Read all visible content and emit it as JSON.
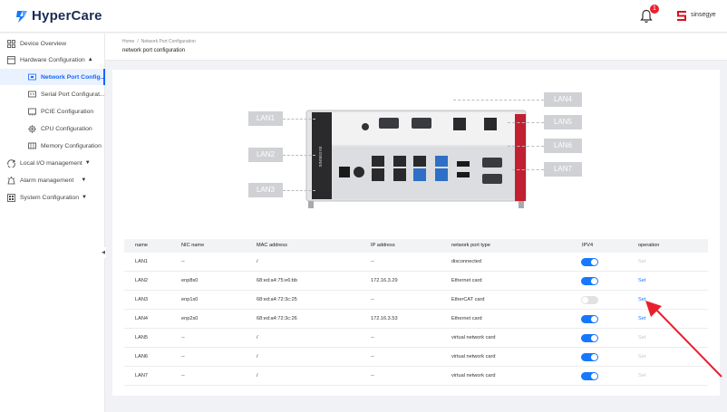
{
  "app": {
    "name": "HyperCare",
    "user": "sinsegye",
    "notification_count": "1",
    "accent_color": "#1677ff",
    "alert_color": "#e8202e"
  },
  "sidebar": {
    "items": [
      {
        "label": "Device Overview",
        "icon": "dashboard-icon"
      },
      {
        "label": "Hardware Configuration",
        "icon": "hardware-icon",
        "expanded": true
      },
      {
        "label": "Network Port Config...",
        "icon": "network-port-icon",
        "active": true
      },
      {
        "label": "Serial Port Configurat...",
        "icon": "serial-port-icon"
      },
      {
        "label": "PCIE Configuration",
        "icon": "pcie-icon"
      },
      {
        "label": "CPU Configuration",
        "icon": "cpu-icon"
      },
      {
        "label": "Memory Configuration",
        "icon": "memory-icon"
      },
      {
        "label": "Local I/O management",
        "icon": "io-icon"
      },
      {
        "label": "Alarm management",
        "icon": "alarm-icon"
      },
      {
        "label": "System Configuration",
        "icon": "system-icon"
      }
    ]
  },
  "breadcrumb": {
    "home": "Home",
    "separator": "/",
    "current": "Network Port Configuration",
    "page_title": "network port configuration"
  },
  "device_labels": [
    "LAN1",
    "LAN2",
    "LAN3",
    "LAN4",
    "LAN5",
    "LAN6",
    "LAN7"
  ],
  "device_text": {
    "brand_vertical": "SINSEGYE"
  },
  "table": {
    "columns": [
      "name",
      "NIC name",
      "MAC address",
      "IP address",
      "network port type",
      "IPV4",
      "operation"
    ],
    "rows": [
      {
        "name": "LAN1",
        "nic": "--",
        "mac": "/",
        "ip": "--",
        "type": "disconnected",
        "ipv4": true,
        "op": "Set",
        "op_enabled": false
      },
      {
        "name": "LAN2",
        "nic": "enp8s0",
        "mac": "68:ed:a4:75:e6:bb",
        "ip": "172.16.3.29",
        "type": "Ethernet card",
        "ipv4": true,
        "op": "Set",
        "op_enabled": true
      },
      {
        "name": "LAN3",
        "nic": "enp1s0",
        "mac": "68:ed:a4:72:3c:25",
        "ip": "--",
        "type": "EtherCAT card",
        "ipv4": false,
        "op": "Set",
        "op_enabled": true
      },
      {
        "name": "LAN4",
        "nic": "enp2s0",
        "mac": "68:ed:a4:72:3c:26",
        "ip": "172.16.3.53",
        "type": "Ethernet card",
        "ipv4": true,
        "op": "Set",
        "op_enabled": true
      },
      {
        "name": "LAN5",
        "nic": "--",
        "mac": "/",
        "ip": "--",
        "type": "virtual network card",
        "ipv4": true,
        "op": "Set",
        "op_enabled": false
      },
      {
        "name": "LAN6",
        "nic": "--",
        "mac": "/",
        "ip": "--",
        "type": "virtual network card",
        "ipv4": true,
        "op": "Set",
        "op_enabled": false
      },
      {
        "name": "LAN7",
        "nic": "--",
        "mac": "/",
        "ip": "--",
        "type": "virtual network card",
        "ipv4": true,
        "op": "Set",
        "op_enabled": false
      }
    ]
  }
}
